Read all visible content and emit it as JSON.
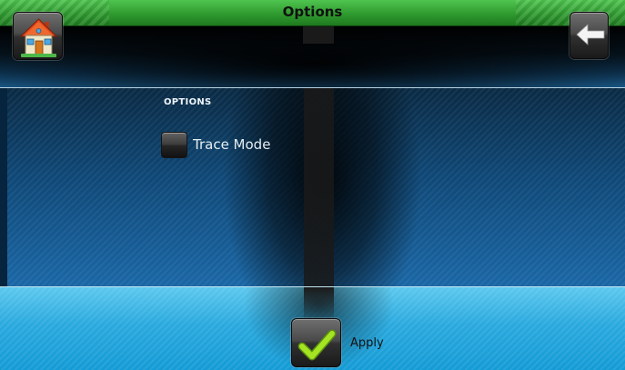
{
  "window": {
    "title": "Options"
  },
  "header": {
    "home_icon": "house-icon",
    "back_icon": "arrow-left-icon"
  },
  "section": {
    "title": "OPTIONS"
  },
  "options": [
    {
      "label": "Trace Mode",
      "checked": false
    }
  ],
  "footer": {
    "apply_label": "Apply",
    "apply_icon": "checkmark-icon"
  },
  "colors": {
    "titlebar": "#2f9a2f",
    "main_bg": "#0f4877",
    "footer_bg": "#2aa9de",
    "check": "#9be01f"
  }
}
